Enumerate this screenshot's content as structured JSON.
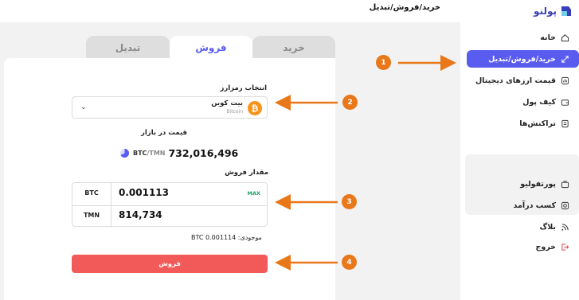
{
  "header": {
    "logo_text": "پولنو",
    "page_title": "خرید/فروش/تبدیل"
  },
  "sidebar": {
    "items": [
      {
        "label": "خانه",
        "icon": "home-icon",
        "active": false
      },
      {
        "label": "خرید/فروش/تبدیل",
        "icon": "exchange-icon",
        "active": true
      },
      {
        "label": "قیمت ارزهای دیجیتال",
        "icon": "price-chart-icon",
        "active": false
      },
      {
        "label": "کیف پول",
        "icon": "wallet-icon",
        "active": false
      },
      {
        "label": "تراکنش‌ها",
        "icon": "transactions-icon",
        "active": false
      },
      {
        "label": "پورتفولیو",
        "icon": "portfolio-icon",
        "active": false
      },
      {
        "label": "کسب درآمد",
        "icon": "earn-icon",
        "active": false
      },
      {
        "label": "بلاگ",
        "icon": "rss-icon",
        "active": false
      },
      {
        "label": "خروج",
        "icon": "logout-icon",
        "active": false
      }
    ]
  },
  "tabs": {
    "buy": "خرید",
    "sell": "فروش",
    "swap": "تبدیل",
    "active": "sell"
  },
  "form": {
    "select_label": "انتخاب رمزارز",
    "coin_name": "بیت کوین",
    "coin_symbol": "Bitcoin",
    "coin_glyph": "₿",
    "market_price_label": "قیمت در بازار",
    "pair_base": "BTC",
    "pair_sep": "/",
    "pair_quote": "TMN",
    "market_price": "732,016,496",
    "amount_label": "مقدار فروش",
    "btc_unit": "BTC",
    "btc_amount": "0.001113",
    "max_label": "MAX",
    "tmn_unit": "TMN",
    "tmn_amount": "814,734",
    "balance_text": "موجودی: BTC 0.001114",
    "sell_button": "فروش"
  },
  "annotations": [
    "1",
    "2",
    "3",
    "4"
  ],
  "colors": {
    "accent": "#5a5cf0",
    "sell": "#f25a5a",
    "annotation": "#e8781a",
    "bitcoin": "#f7931a",
    "max": "#1aa36b"
  }
}
